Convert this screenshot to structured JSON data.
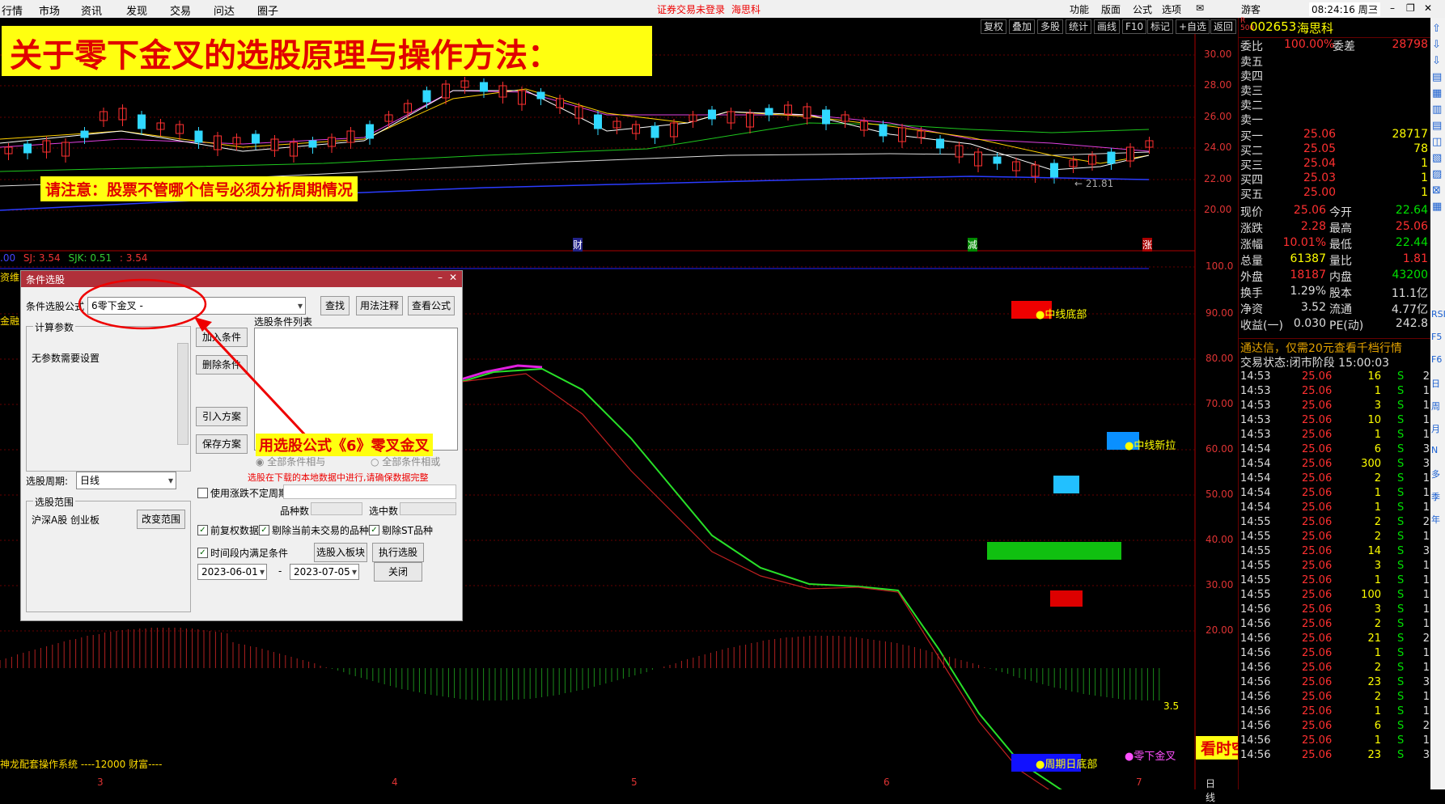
{
  "menu": {
    "items": [
      "行情",
      "市场",
      "资讯",
      "发现",
      "交易",
      "问达",
      "圈子"
    ],
    "login_status": "证券交易未登录",
    "broker": "海思科",
    "right_items": [
      "功能",
      "版面",
      "公式",
      "选项"
    ],
    "user": "游客",
    "clock": "08:24:16 周三"
  },
  "chart_toolbar": {
    "buttons": [
      "复权",
      "叠加",
      "多股",
      "统计",
      "画线",
      "F10",
      "标记",
      "+自选",
      "返回"
    ]
  },
  "overlay": {
    "headline": "关于零下金叉的选股原理与操作方法：",
    "notice": "请注意：股票不管哪个信号必须分析周期情况",
    "arrow_label": "用选股公式《6》零叉金叉",
    "bottom_label": "看时空线在零下开始金叉"
  },
  "price_axis": [
    "30.00",
    "28.00",
    "26.00",
    "24.00",
    "22.00",
    "20.00"
  ],
  "low_marker": "21.81",
  "event_markers": [
    "财",
    "减",
    "涨"
  ],
  "indicator_line": {
    "items": [
      ".00",
      "SJ: 3.54",
      "SJK: 0.51",
      ": 3.54"
    ]
  },
  "indicator_axis": [
    "100.0",
    "90.00",
    "80.00",
    "70.00",
    "60.00",
    "50.00",
    "40.00",
    "30.00",
    "20.00"
  ],
  "signals": {
    "mid_bottom": "●中线底部",
    "mid_breakout": "●中线新拉",
    "cycle_bottom": "●周期日底部",
    "zero_cross": "●零下金叉",
    "hist_value": "3.5"
  },
  "footer_system": "神龙配套操作系统 ----12000 财富----",
  "left_stubs": [
    "资维",
    "金融"
  ],
  "x_ticks": [
    "3",
    "4",
    "5",
    "6",
    "7"
  ],
  "x_axis_label": "日线",
  "dialog": {
    "title": "条件选股",
    "formula_label": "条件选股公式",
    "formula_value": "6零下金叉   -",
    "btn_find": "查找",
    "btn_usage": "用法注释",
    "btn_view": "查看公式",
    "calc_params_title": "计算参数",
    "no_params": "无参数需要设置",
    "cond_list_title": "选股条件列表",
    "btn_add": "加入条件",
    "btn_delete": "删除条件",
    "btn_import": "引入方案",
    "btn_save": "保存方案",
    "period_label": "选股周期:",
    "period_value": "日线",
    "radio_and": "全部条件相与",
    "radio_or": "全部条件相或",
    "warning": "选股在下载的本地数据中进行,请确保数据完整",
    "scope_title": "选股范围",
    "scope_value": "沪深A股 创业板",
    "btn_change_scope": "改变范围",
    "chk_volatile": "使用涨跌不定周期",
    "stock_count_label": "品种数",
    "selected_label": "选中数",
    "chk_prev_adj": "前复权数据",
    "chk_rm_notrade": "剔除当前未交易的品种",
    "chk_rm_st": "剔除ST品种",
    "chk_timeframe": "时间段内满足条件",
    "btn_to_block": "选股入板块",
    "btn_execute": "执行选股",
    "date_from": "2023-06-01",
    "date_to": "2023-07-05",
    "date_sep": "-",
    "btn_close": "关闭"
  },
  "panel": {
    "code": "002653",
    "name": "海思科",
    "badge_top": "R",
    "badge_bot": "500",
    "webi_label": "委比",
    "webi_value": "100.00%",
    "weicha_label": "委差",
    "weicha_value": "28798",
    "sells": [
      {
        "label": "卖五"
      },
      {
        "label": "卖四"
      },
      {
        "label": "卖三"
      },
      {
        "label": "卖二"
      },
      {
        "label": "卖一"
      }
    ],
    "buys": [
      {
        "label": "买一",
        "price": "25.06",
        "vol": "28717"
      },
      {
        "label": "买二",
        "price": "25.05",
        "vol": "78"
      },
      {
        "label": "买三",
        "price": "25.04",
        "vol": "1"
      },
      {
        "label": "买四",
        "price": "25.03",
        "vol": "1"
      },
      {
        "label": "买五",
        "price": "25.00",
        "vol": "1"
      }
    ],
    "quote": [
      {
        "l1": "现价",
        "v1": "25.06",
        "l2": "今开",
        "v2": "22.64"
      },
      {
        "l1": "涨跌",
        "v1": "2.28",
        "l2": "最高",
        "v2": "25.06"
      },
      {
        "l1": "涨幅",
        "v1": "10.01%",
        "l2": "最低",
        "v2": "22.44"
      },
      {
        "l1": "总量",
        "v1": "61387",
        "l2": "量比",
        "v2": "1.81"
      },
      {
        "l1": "外盘",
        "v1": "18187",
        "l2": "内盘",
        "v2": "43200"
      },
      {
        "l1": "换手",
        "v1": "1.29%",
        "l2": "股本",
        "v2": "11.1亿"
      },
      {
        "l1": "净资",
        "v1": "3.52",
        "l2": "流通",
        "v2": "4.77亿"
      },
      {
        "l1": "收益(一)",
        "v1": "0.030",
        "l2": "PE(动)",
        "v2": "242.8"
      }
    ],
    "promo": "通达信，仅需20元查看千档行情",
    "trade_state": "交易状态:闭市阶段 15:00:03",
    "ticks": [
      {
        "t": "14:53",
        "p": "25.06",
        "v": "16",
        "s": "S",
        "n": "2"
      },
      {
        "t": "14:53",
        "p": "25.06",
        "v": "1",
        "s": "S",
        "n": "1"
      },
      {
        "t": "14:53",
        "p": "25.06",
        "v": "3",
        "s": "S",
        "n": "1"
      },
      {
        "t": "14:53",
        "p": "25.06",
        "v": "10",
        "s": "S",
        "n": "1"
      },
      {
        "t": "14:53",
        "p": "25.06",
        "v": "1",
        "s": "S",
        "n": "1"
      },
      {
        "t": "14:54",
        "p": "25.06",
        "v": "6",
        "s": "S",
        "n": "3"
      },
      {
        "t": "14:54",
        "p": "25.06",
        "v": "300",
        "s": "S",
        "n": "3"
      },
      {
        "t": "14:54",
        "p": "25.06",
        "v": "2",
        "s": "S",
        "n": "1"
      },
      {
        "t": "14:54",
        "p": "25.06",
        "v": "1",
        "s": "S",
        "n": "1"
      },
      {
        "t": "14:54",
        "p": "25.06",
        "v": "1",
        "s": "S",
        "n": "1"
      },
      {
        "t": "14:55",
        "p": "25.06",
        "v": "2",
        "s": "S",
        "n": "2"
      },
      {
        "t": "14:55",
        "p": "25.06",
        "v": "2",
        "s": "S",
        "n": "1"
      },
      {
        "t": "14:55",
        "p": "25.06",
        "v": "14",
        "s": "S",
        "n": "3"
      },
      {
        "t": "14:55",
        "p": "25.06",
        "v": "3",
        "s": "S",
        "n": "1"
      },
      {
        "t": "14:55",
        "p": "25.06",
        "v": "1",
        "s": "S",
        "n": "1"
      },
      {
        "t": "14:55",
        "p": "25.06",
        "v": "100",
        "s": "S",
        "n": "1"
      },
      {
        "t": "14:56",
        "p": "25.06",
        "v": "3",
        "s": "S",
        "n": "1"
      },
      {
        "t": "14:56",
        "p": "25.06",
        "v": "2",
        "s": "S",
        "n": "1"
      },
      {
        "t": "14:56",
        "p": "25.06",
        "v": "21",
        "s": "S",
        "n": "2"
      },
      {
        "t": "14:56",
        "p": "25.06",
        "v": "1",
        "s": "S",
        "n": "1"
      },
      {
        "t": "14:56",
        "p": "25.06",
        "v": "2",
        "s": "S",
        "n": "1"
      },
      {
        "t": "14:56",
        "p": "25.06",
        "v": "23",
        "s": "S",
        "n": "3"
      },
      {
        "t": "14:56",
        "p": "25.06",
        "v": "2",
        "s": "S",
        "n": "1"
      },
      {
        "t": "14:56",
        "p": "25.06",
        "v": "1",
        "s": "S",
        "n": "1"
      },
      {
        "t": "14:56",
        "p": "25.06",
        "v": "6",
        "s": "S",
        "n": "2"
      },
      {
        "t": "14:56",
        "p": "25.06",
        "v": "1",
        "s": "S",
        "n": "1"
      },
      {
        "t": "14:56",
        "p": "25.06",
        "v": "23",
        "s": "S",
        "n": "3"
      }
    ]
  },
  "side_icons": [
    "RSI",
    "F5",
    "F6",
    "日",
    "周",
    "月",
    "N",
    "多",
    "季",
    "年"
  ]
}
